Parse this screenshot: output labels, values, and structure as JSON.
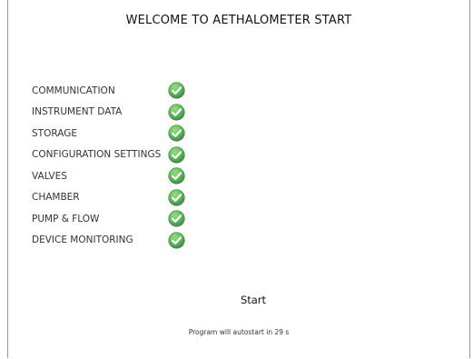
{
  "title": "WELCOME TO AETHALOMETER START",
  "checks": [
    {
      "label": "COMMUNICATION",
      "status": "ok",
      "icon": "check-circle-icon"
    },
    {
      "label": "INSTRUMENT DATA",
      "status": "ok",
      "icon": "check-circle-icon"
    },
    {
      "label": "STORAGE",
      "status": "ok",
      "icon": "check-circle-icon"
    },
    {
      "label": "CONFIGURATION SETTINGS",
      "status": "ok",
      "icon": "check-circle-icon"
    },
    {
      "label": "VALVES",
      "status": "ok",
      "icon": "check-circle-icon"
    },
    {
      "label": "CHAMBER",
      "status": "ok",
      "icon": "check-circle-icon"
    },
    {
      "label": "PUMP & FLOW",
      "status": "ok",
      "icon": "check-circle-icon"
    },
    {
      "label": "DEVICE MONITORING",
      "status": "ok",
      "icon": "check-circle-icon"
    }
  ],
  "start_button": {
    "label": "Start"
  },
  "autostart": {
    "text": "Program will autostart in 29 s"
  },
  "colors": {
    "check_green": "#5cb85c",
    "check_green_light": "#9bdc83",
    "check_green_dark": "#3d8b3d"
  }
}
